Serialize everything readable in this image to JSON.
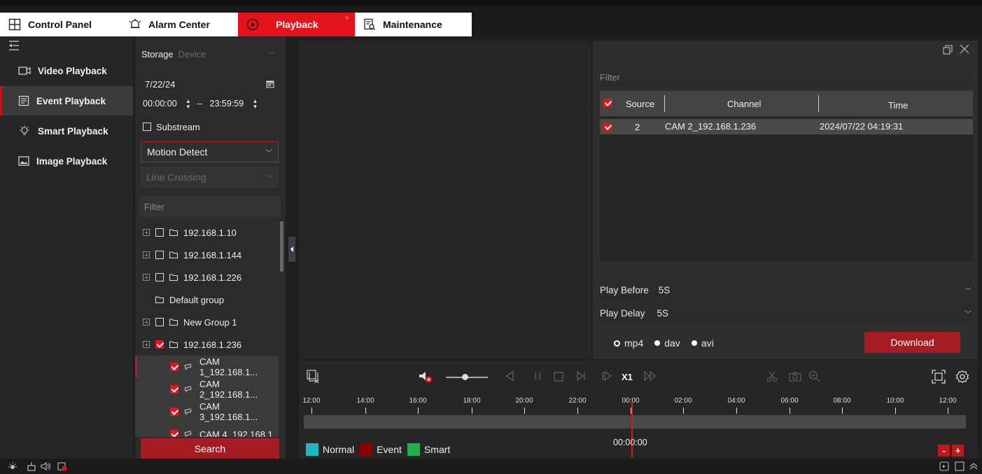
{
  "tabs": [
    {
      "label": "Control Panel",
      "icon": "grid-icon"
    },
    {
      "label": "Alarm Center",
      "icon": "bell-icon"
    },
    {
      "label": "Playback",
      "icon": "play-circle-icon",
      "active": true
    },
    {
      "label": "Maintenance",
      "icon": "maintenance-icon"
    }
  ],
  "leftnav": {
    "items": [
      {
        "label": "Video Playback",
        "icon": "video-camera-icon"
      },
      {
        "label": "Event Playback",
        "icon": "event-list-icon",
        "active": true
      },
      {
        "label": "Smart Playback",
        "icon": "smart-bulb-icon"
      },
      {
        "label": "Image Playback",
        "icon": "image-icon"
      }
    ]
  },
  "search": {
    "storage_label": "Storage",
    "storage_value": "Device",
    "date": "7/22/24",
    "start_time": "00:00:00",
    "separator": "--",
    "end_time": "23:59:59",
    "substream_label": "Substream",
    "event_type": "Motion Detect",
    "event_subtype": "Line Crossing",
    "filter_placeholder": "Filter",
    "tree": [
      {
        "label": "192.168.1.10",
        "checked": false
      },
      {
        "label": "192.168.1.144",
        "checked": false
      },
      {
        "label": "192.168.1.226",
        "checked": false
      },
      {
        "label": "Default group",
        "checked": false
      },
      {
        "label": "New Group 1",
        "checked": false
      },
      {
        "label": "192.168.1.236",
        "checked": true
      }
    ],
    "cameras": [
      {
        "label": "CAM 1_192.168.1...",
        "checked": true
      },
      {
        "label": "CAM 2_192.168.1...",
        "checked": true
      },
      {
        "label": "CAM 3_192.168.1...",
        "checked": true
      },
      {
        "label": "CAM 4_192.168.1",
        "checked": true
      }
    ],
    "search_button": "Search"
  },
  "event_list": {
    "filter_placeholder": "Filter",
    "columns": [
      "Source",
      "Channel",
      "Time"
    ],
    "rows": [
      {
        "source": "2",
        "channel": "CAM 2_192.168.1.236",
        "time": "2024/07/22 04:19:31",
        "checked": true
      }
    ],
    "play_before_label": "Play Before",
    "play_before_value": "5S",
    "play_delay_label": "Play Delay",
    "play_delay_value": "5S",
    "formats": [
      {
        "label": "mp4",
        "selected": true
      },
      {
        "label": "dav",
        "selected": false
      },
      {
        "label": "avi",
        "selected": false
      }
    ],
    "download_button": "Download"
  },
  "playback": {
    "speed": "X1",
    "timeline_labels": [
      "12:00",
      "14:00",
      "16:00",
      "18:00",
      "20:00",
      "22:00",
      "00:00",
      "02:00",
      "04:00",
      "06:00",
      "08:00",
      "10:00",
      "12:00"
    ],
    "current_time": "00:00:00",
    "legend": [
      {
        "label": "Normal",
        "color": "#1fb6c1"
      },
      {
        "label": "Event",
        "color": "#8b0000"
      },
      {
        "label": "Smart",
        "color": "#22b04a"
      }
    ],
    "zoom_out": "-",
    "zoom_in": "+"
  },
  "colors": {
    "accent": "#e5131c",
    "button_red": "#a51c22"
  }
}
